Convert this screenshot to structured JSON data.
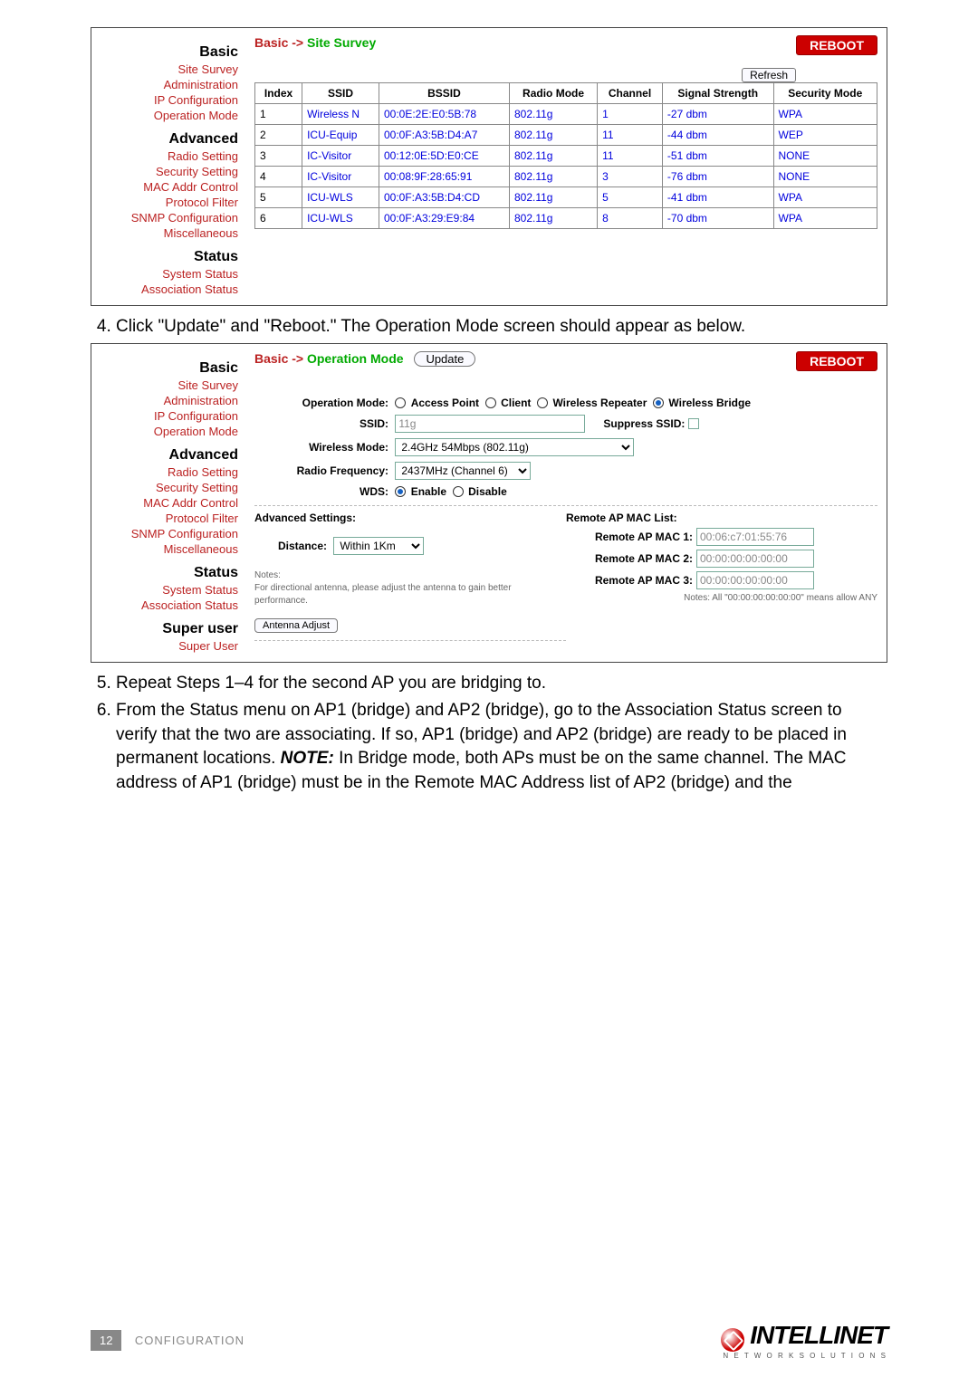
{
  "sidebar": {
    "basic_h": "Basic",
    "basic": [
      "Site Survey",
      "Administration",
      "IP Configuration",
      "Operation Mode"
    ],
    "advanced_h": "Advanced",
    "advanced": [
      "Radio Setting",
      "Security Setting",
      "MAC Addr Control",
      "Protocol Filter",
      "SNMP Configuration",
      "Miscellaneous"
    ],
    "status_h": "Status",
    "status": [
      "System Status",
      "Association Status"
    ],
    "super_h": "Super user",
    "super": [
      "Super User"
    ]
  },
  "survey": {
    "crumb_a": "Basic",
    "crumb_arrow": "->",
    "crumb_b": "Site Survey",
    "reboot": "REBOOT",
    "refresh": "Refresh",
    "headers": [
      "Index",
      "SSID",
      "BSSID",
      "Radio Mode",
      "Channel",
      "Signal Strength",
      "Security Mode"
    ],
    "rows": [
      {
        "i": "1",
        "ssid": "Wireless N",
        "bssid": "00:0E:2E:E0:5B:78",
        "rm": "802.11g",
        "ch": "1",
        "sig": "-27 dbm",
        "sec": "WPA"
      },
      {
        "i": "2",
        "ssid": "ICU-Equip",
        "bssid": "00:0F:A3:5B:D4:A7",
        "rm": "802.11g",
        "ch": "11",
        "sig": "-44 dbm",
        "sec": "WEP"
      },
      {
        "i": "3",
        "ssid": "IC-Visitor",
        "bssid": "00:12:0E:5D:E0:CE",
        "rm": "802.11g",
        "ch": "11",
        "sig": "-51 dbm",
        "sec": "NONE"
      },
      {
        "i": "4",
        "ssid": "IC-Visitor",
        "bssid": "00:08:9F:28:65:91",
        "rm": "802.11g",
        "ch": "3",
        "sig": "-76 dbm",
        "sec": "NONE"
      },
      {
        "i": "5",
        "ssid": "ICU-WLS",
        "bssid": "00:0F:A3:5B:D4:CD",
        "rm": "802.11g",
        "ch": "5",
        "sig": "-41 dbm",
        "sec": "WPA"
      },
      {
        "i": "6",
        "ssid": "ICU-WLS",
        "bssid": "00:0F:A3:29:E9:84",
        "rm": "802.11g",
        "ch": "8",
        "sig": "-70 dbm",
        "sec": "WPA"
      }
    ]
  },
  "step4": "Click \"Update\" and \"Reboot.\" The Operation Mode screen should appear as below.",
  "op": {
    "crumb_a": "Basic",
    "crumb_arrow": "->",
    "crumb_b": "Operation Mode",
    "update": "Update",
    "reboot": "REBOOT",
    "mode_lbl": "Operation Mode:",
    "modes": [
      "Access Point",
      "Client",
      "Wireless Repeater",
      "Wireless Bridge"
    ],
    "selected_mode_idx": 3,
    "ssid_lbl": "SSID:",
    "ssid_val": "11g",
    "suppress_lbl": "Suppress SSID:",
    "wmode_lbl": "Wireless Mode:",
    "wmode_val": "2.4GHz 54Mbps (802.11g)",
    "rf_lbl": "Radio Frequency:",
    "rf_val": "2437MHz (Channel 6)",
    "wds_lbl": "WDS:",
    "wds_opts": [
      "Enable",
      "Disable"
    ],
    "wds_sel_idx": 0,
    "adv_h": "Advanced Settings:",
    "dist_lbl": "Distance:",
    "dist_val": "Within 1Km",
    "notes_h": "Notes:",
    "notes_body": "For directional antenna, please adjust the antenna to gain better performance.",
    "antenna_btn": "Antenna Adjust",
    "remote_h": "Remote AP MAC List:",
    "remote": [
      {
        "lbl": "Remote AP MAC 1:",
        "val": "00:06:c7:01:55:76"
      },
      {
        "lbl": "Remote AP MAC 2:",
        "val": "00:00:00:00:00:00"
      },
      {
        "lbl": "Remote AP MAC 3:",
        "val": "00:00:00:00:00:00"
      }
    ],
    "remote_note": "Notes: All \"00:00:00:00:00:00\" means allow ANY"
  },
  "step5": "Repeat Steps 1–4 for the second AP you are bridging to.",
  "step6": "From the Status menu on AP1 (bridge) and AP2 (bridge), go to the Association Status screen to verify that the two are associating. If so, AP1 (bridge) and AP2 (bridge) are ready to be placed in permanent locations. ",
  "step6_note": "NOTE:",
  "step6_after": " In Bridge mode, both APs must be on the same channel. The MAC address of AP1 (bridge) must be in the Remote MAC Address list of AP2 (bridge) and the",
  "footer": {
    "page": "12",
    "section": "CONFIGURATION",
    "brand": "INTELLINET",
    "brand_sub": "N E T W O R K   S O L U T I O N S"
  }
}
